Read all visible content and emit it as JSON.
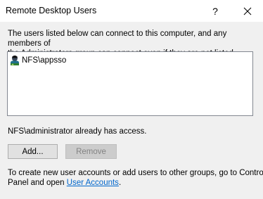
{
  "window": {
    "title": "Remote Desktop Users",
    "help_label": "?"
  },
  "intro": {
    "text": "The users listed below can connect to this computer, and any members of\nthe Administrators group can connect even if they are not listed."
  },
  "user_list": {
    "items": [
      {
        "label": "NFS\\appsso",
        "icon": "user-icon"
      }
    ]
  },
  "status": {
    "access_text": "NFS\\administrator already has access."
  },
  "buttons": {
    "add_label": "Add...",
    "remove_label": "Remove"
  },
  "footer": {
    "line1": "To create new user accounts or add users to other groups, go to Control",
    "line2_prefix": "Panel and open ",
    "link_label": "User Accounts",
    "line2_suffix": "."
  },
  "colors": {
    "link": "#0066cc",
    "titlebar": "#ffffff",
    "dialog_bg": "#f0f0f0"
  }
}
